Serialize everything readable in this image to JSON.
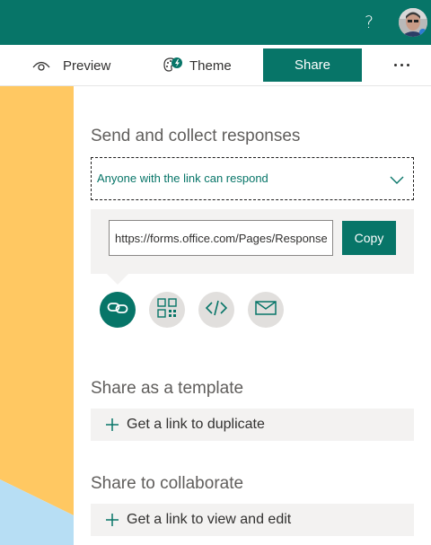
{
  "topbar": {
    "help_label": "?",
    "accent_color": "#077568"
  },
  "commandbar": {
    "preview_label": "Preview",
    "theme_label": "Theme",
    "share_label": "Share"
  },
  "share": {
    "send_title": "Send and collect responses",
    "permission_selected": "Anyone with the link can respond",
    "link_url": "https://forms.office.com/Pages/ResponsePage.aspx",
    "copy_label": "Copy",
    "options": [
      {
        "icon": "link-icon",
        "active": true
      },
      {
        "icon": "qr-code-icon",
        "active": false
      },
      {
        "icon": "embed-code-icon",
        "active": false
      },
      {
        "icon": "email-icon",
        "active": false
      }
    ],
    "template_title": "Share as a template",
    "duplicate_link_label": "Get a link to duplicate",
    "collaborate_title": "Share to collaborate",
    "view_edit_link_label": "Get a link to view and edit"
  }
}
